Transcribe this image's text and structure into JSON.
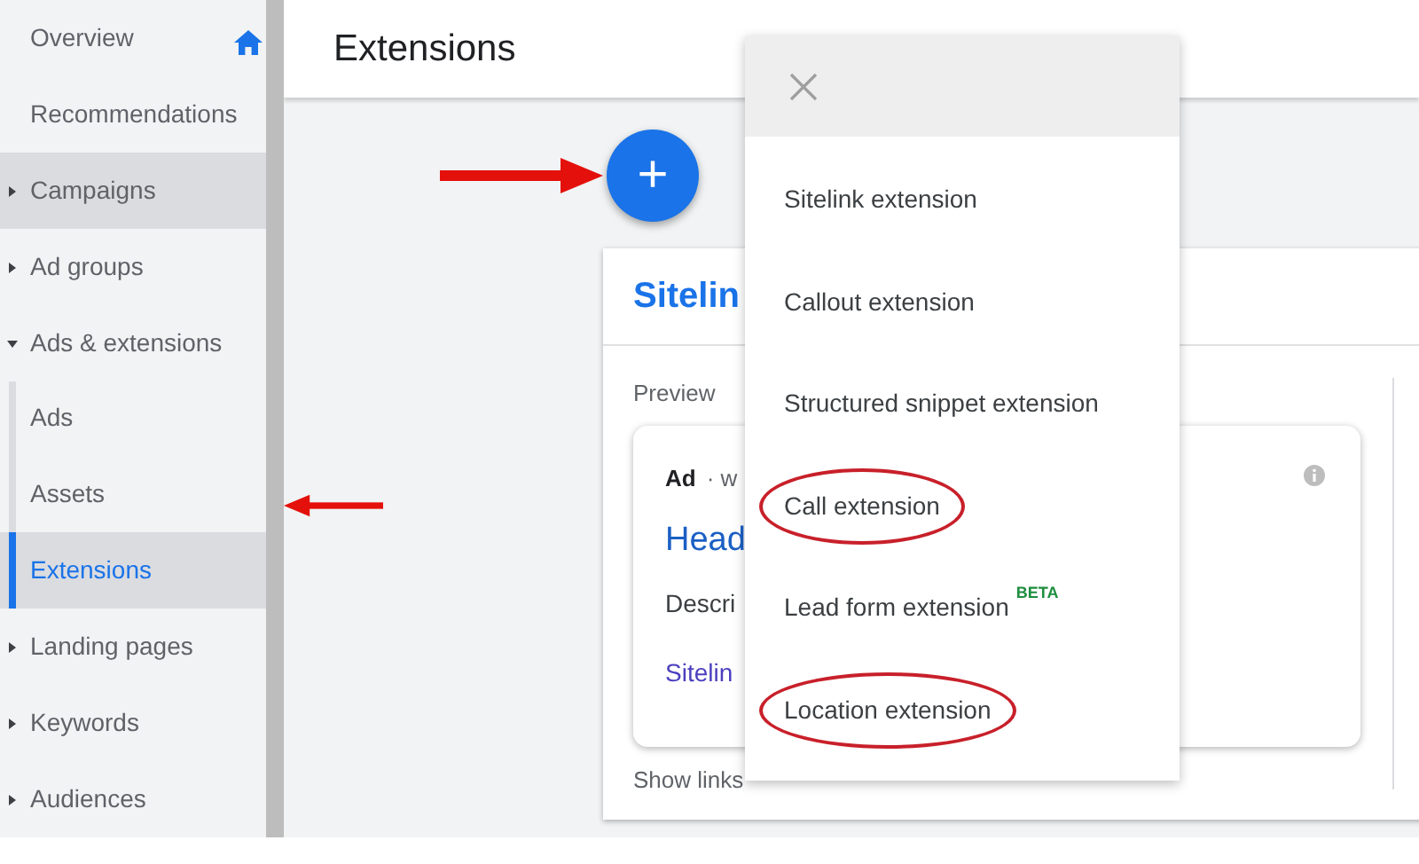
{
  "sidebar": {
    "items": [
      {
        "label": "Overview",
        "kind": "home",
        "selected": false,
        "hovered": false
      },
      {
        "label": "Recommendations",
        "kind": "link",
        "selected": false,
        "hovered": false
      },
      {
        "label": "Campaigns",
        "kind": "group",
        "expanded": false,
        "selected": false,
        "hovered": true
      },
      {
        "label": "Ad groups",
        "kind": "group",
        "expanded": false,
        "selected": false,
        "hovered": false
      },
      {
        "label": "Ads & extensions",
        "kind": "group",
        "expanded": true,
        "selected": false,
        "hovered": false,
        "children": [
          {
            "label": "Ads",
            "selected": false
          },
          {
            "label": "Assets",
            "selected": false
          },
          {
            "label": "Extensions",
            "selected": true
          }
        ]
      },
      {
        "label": "Landing pages",
        "kind": "group",
        "expanded": false,
        "selected": false,
        "hovered": false
      },
      {
        "label": "Keywords",
        "kind": "group",
        "expanded": false,
        "selected": false,
        "hovered": false
      },
      {
        "label": "Audiences",
        "kind": "group",
        "expanded": false,
        "selected": false,
        "hovered": false
      }
    ]
  },
  "header": {
    "title": "Extensions"
  },
  "add_button": {
    "label": "+"
  },
  "card": {
    "title": "Sitelin",
    "preview_label": "Preview",
    "ad": {
      "badge": "Ad",
      "url": "· w",
      "headline": "Head",
      "description": "Descri",
      "sitelinks": "Sitelin"
    },
    "footer": "Show links"
  },
  "menu": {
    "items": [
      {
        "label": "Sitelink extension",
        "circled": false
      },
      {
        "label": "Callout extension",
        "circled": false
      },
      {
        "label": "Structured snippet extension",
        "circled": false
      },
      {
        "label": "Call extension",
        "circled": true
      },
      {
        "label": "Lead form extension",
        "badge": "BETA",
        "circled": false
      },
      {
        "label": "Location extension",
        "circled": true
      }
    ]
  }
}
